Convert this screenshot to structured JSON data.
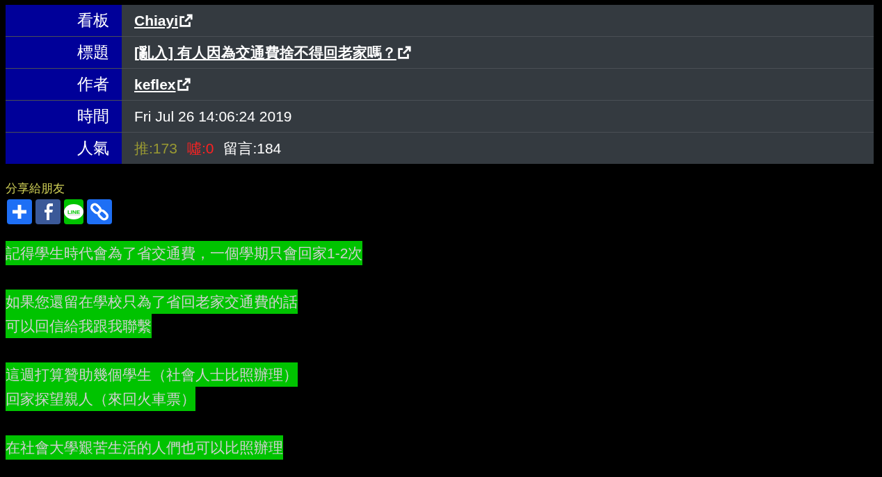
{
  "meta_table": {
    "rows": [
      {
        "label": "看板",
        "kind": "link",
        "value": "Chiayi"
      },
      {
        "label": "標題",
        "kind": "link",
        "value": "[亂入] 有人因為交通費捨不得回老家嗎？"
      },
      {
        "label": "作者",
        "kind": "link",
        "value": "keflex"
      },
      {
        "label": "時間",
        "kind": "text",
        "value": "Fri Jul 26 14:06:24 2019"
      },
      {
        "label": "人氣",
        "kind": "stats",
        "stats": [
          {
            "kind": "push",
            "text": "推:173"
          },
          {
            "kind": "boo",
            "text": "噓:0"
          },
          {
            "kind": "comment",
            "text": "留言:184"
          }
        ]
      }
    ]
  },
  "share": {
    "label": "分享給朋友",
    "buttons": [
      {
        "kind": "plus"
      },
      {
        "kind": "facebook"
      },
      {
        "kind": "line",
        "text": "LINE"
      },
      {
        "kind": "link"
      }
    ]
  },
  "body": {
    "paragraphs": [
      [
        "記得學生時代會為了省交通費，一個學期只會回家1-2次"
      ],
      [
        "如果您還留在學校只為了省回老家交通費的話",
        "可以回信給我跟我聯繫"
      ],
      [
        "這週打算贊助幾個學生（社會人士比照辦理）",
        "回家探望親人（來回火車票）"
      ],
      [
        "在社會大學艱苦生活的人們也可以比照辦理"
      ]
    ]
  }
}
